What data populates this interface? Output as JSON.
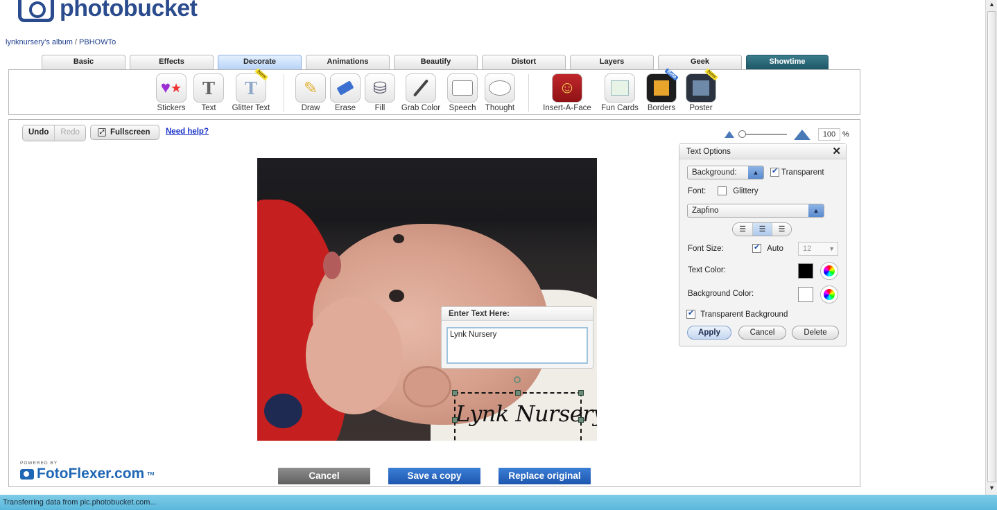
{
  "header": {
    "brand": "photobucket",
    "breadcrumb": {
      "album": "lynknursery's album",
      "separator": "/",
      "folder": "PBHOWTo"
    }
  },
  "tabs": [
    {
      "label": "Basic"
    },
    {
      "label": "Effects"
    },
    {
      "label": "Decorate",
      "active": true
    },
    {
      "label": "Animations"
    },
    {
      "label": "Beautify"
    },
    {
      "label": "Distort"
    },
    {
      "label": "Layers"
    },
    {
      "label": "Geek"
    },
    {
      "label": "Showtime"
    }
  ],
  "tools": [
    {
      "label": "Stickers",
      "icon": "stickers-icon"
    },
    {
      "label": "Text",
      "icon": "text-icon"
    },
    {
      "label": "Glitter Text",
      "icon": "glitter-text-icon",
      "badge": "New"
    },
    {
      "label": "Draw",
      "icon": "pencil-icon"
    },
    {
      "label": "Erase",
      "icon": "eraser-icon"
    },
    {
      "label": "Fill",
      "icon": "paint-bucket-icon"
    },
    {
      "label": "Grab Color",
      "icon": "eyedropper-icon"
    },
    {
      "label": "Speech",
      "icon": "speech-bubble-icon"
    },
    {
      "label": "Thought",
      "icon": "thought-bubble-icon"
    },
    {
      "label": "Insert-A-Face",
      "icon": "insert-face-icon"
    },
    {
      "label": "Fun Cards",
      "icon": "fun-cards-icon"
    },
    {
      "label": "Borders",
      "icon": "borders-icon",
      "badge": "Beta"
    },
    {
      "label": "Poster",
      "icon": "poster-icon",
      "badge": "New"
    }
  ],
  "editor": {
    "undo": "Undo",
    "redo": "Redo",
    "fullscreen": "Fullscreen",
    "help": "Need help?",
    "zoom_value": "100",
    "zoom_unit": "%"
  },
  "enter_text": {
    "title": "Enter Text Here:",
    "value": "Lynk Nursery"
  },
  "canvas_text": "Lynk Nursery",
  "text_options": {
    "title": "Text Options",
    "background_select": "Background:",
    "transparent_label": "Transparent",
    "transparent_checked": true,
    "font_label": "Font:",
    "glittery_label": "Glittery",
    "glittery_checked": false,
    "font_select": "Zapfino",
    "alignment_selected": "center",
    "font_size_label": "Font Size:",
    "auto_label": "Auto",
    "auto_checked": true,
    "font_size_value": "12",
    "text_color_label": "Text Color:",
    "text_color": "#000000",
    "bg_color_label": "Background Color:",
    "bg_color": "#ffffff",
    "transparent_bg_label": "Transparent Background",
    "transparent_bg_checked": true,
    "apply": "Apply",
    "cancel": "Cancel",
    "delete": "Delete"
  },
  "powered": {
    "label": "POWERED BY",
    "brand": "FotoFlexer.com",
    "tm": "TM"
  },
  "actions": {
    "cancel": "Cancel",
    "save_copy": "Save a copy",
    "replace": "Replace original"
  },
  "status_bar": "Transferring data from pic.photobucket.com..."
}
